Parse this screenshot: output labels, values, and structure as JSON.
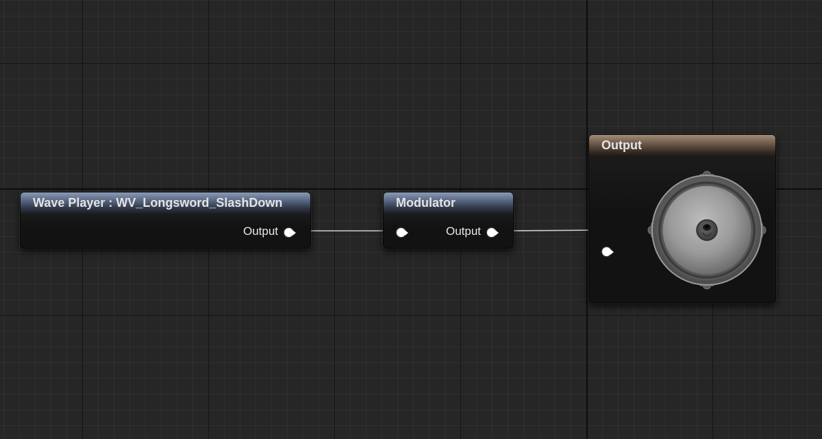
{
  "graph": {
    "nodes": {
      "wave_player": {
        "title": "Wave Player : WV_Longsword_SlashDown",
        "output_label": "Output",
        "header_color": "#566581"
      },
      "modulator": {
        "title": "Modulator",
        "output_label": "Output",
        "header_color": "#566581"
      },
      "output": {
        "title": "Output",
        "header_color": "#6e5b4b",
        "icon": "speaker-icon"
      }
    },
    "colors": {
      "background": "#262626",
      "wire": "#d0d0d0",
      "pin": "#ffffff"
    }
  }
}
